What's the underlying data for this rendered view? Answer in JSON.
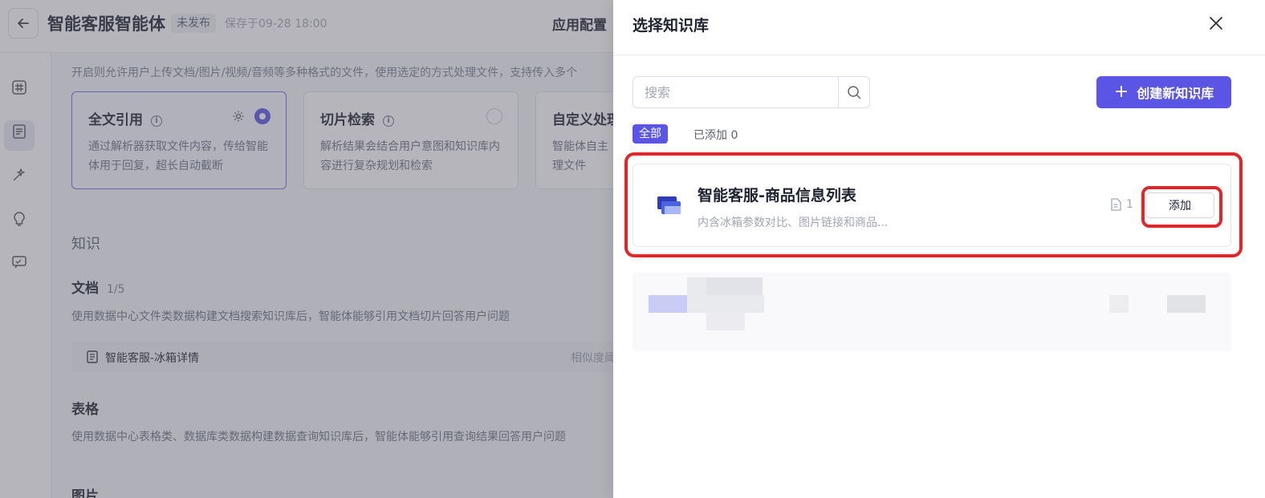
{
  "app": {
    "title": "智能客服智能体",
    "status": "未发布",
    "saved": "保存于09-28 18:00",
    "config_tab": "应用配置"
  },
  "content": {
    "upload_desc": "开启则允许用户上传文档/图片/视频/音频等多种格式的文件，使用选定的方式处理文件，支持传入多个",
    "modes": [
      {
        "title": "全文引用",
        "desc": "通过解析器获取文件内容，传给智能体用于回复，超长自动截断",
        "selected": true
      },
      {
        "title": "切片检索",
        "desc": "解析结果会结合用户意图和知识库内容进行复杂规划和检索",
        "selected": false
      },
      {
        "title": "自定义处理",
        "desc": "智能体自主理文件",
        "selected": false
      }
    ],
    "knowledge_heading": "知识",
    "doc_heading": "文档",
    "doc_count": "1/5",
    "doc_desc": "使用数据中心文件类数据构建文档搜索知识库后，智能体能够引用文档切片回答用户问题",
    "doc_item_name": "智能客服-冰箱详情",
    "doc_item_sim": "相似度阈",
    "table_heading": "表格",
    "table_desc": "使用数据中心表格类、数据库类数据构建数据查询知识库后，智能体能够引用查询结果回答用户问题",
    "image_heading": "图片"
  },
  "drawer": {
    "title": "选择知识库",
    "search_placeholder": "搜索",
    "create_label": "创建新知识库",
    "filter_all": "全部",
    "filter_added": "已添加 0",
    "kb_items": [
      {
        "name": "智能客服-商品信息列表",
        "desc": "内含冰箱参数对比、图片链接和商品...",
        "doc_count": "1",
        "action": "添加"
      }
    ]
  },
  "colors": {
    "primary": "#5b55e6",
    "highlight": "#e0262b"
  }
}
